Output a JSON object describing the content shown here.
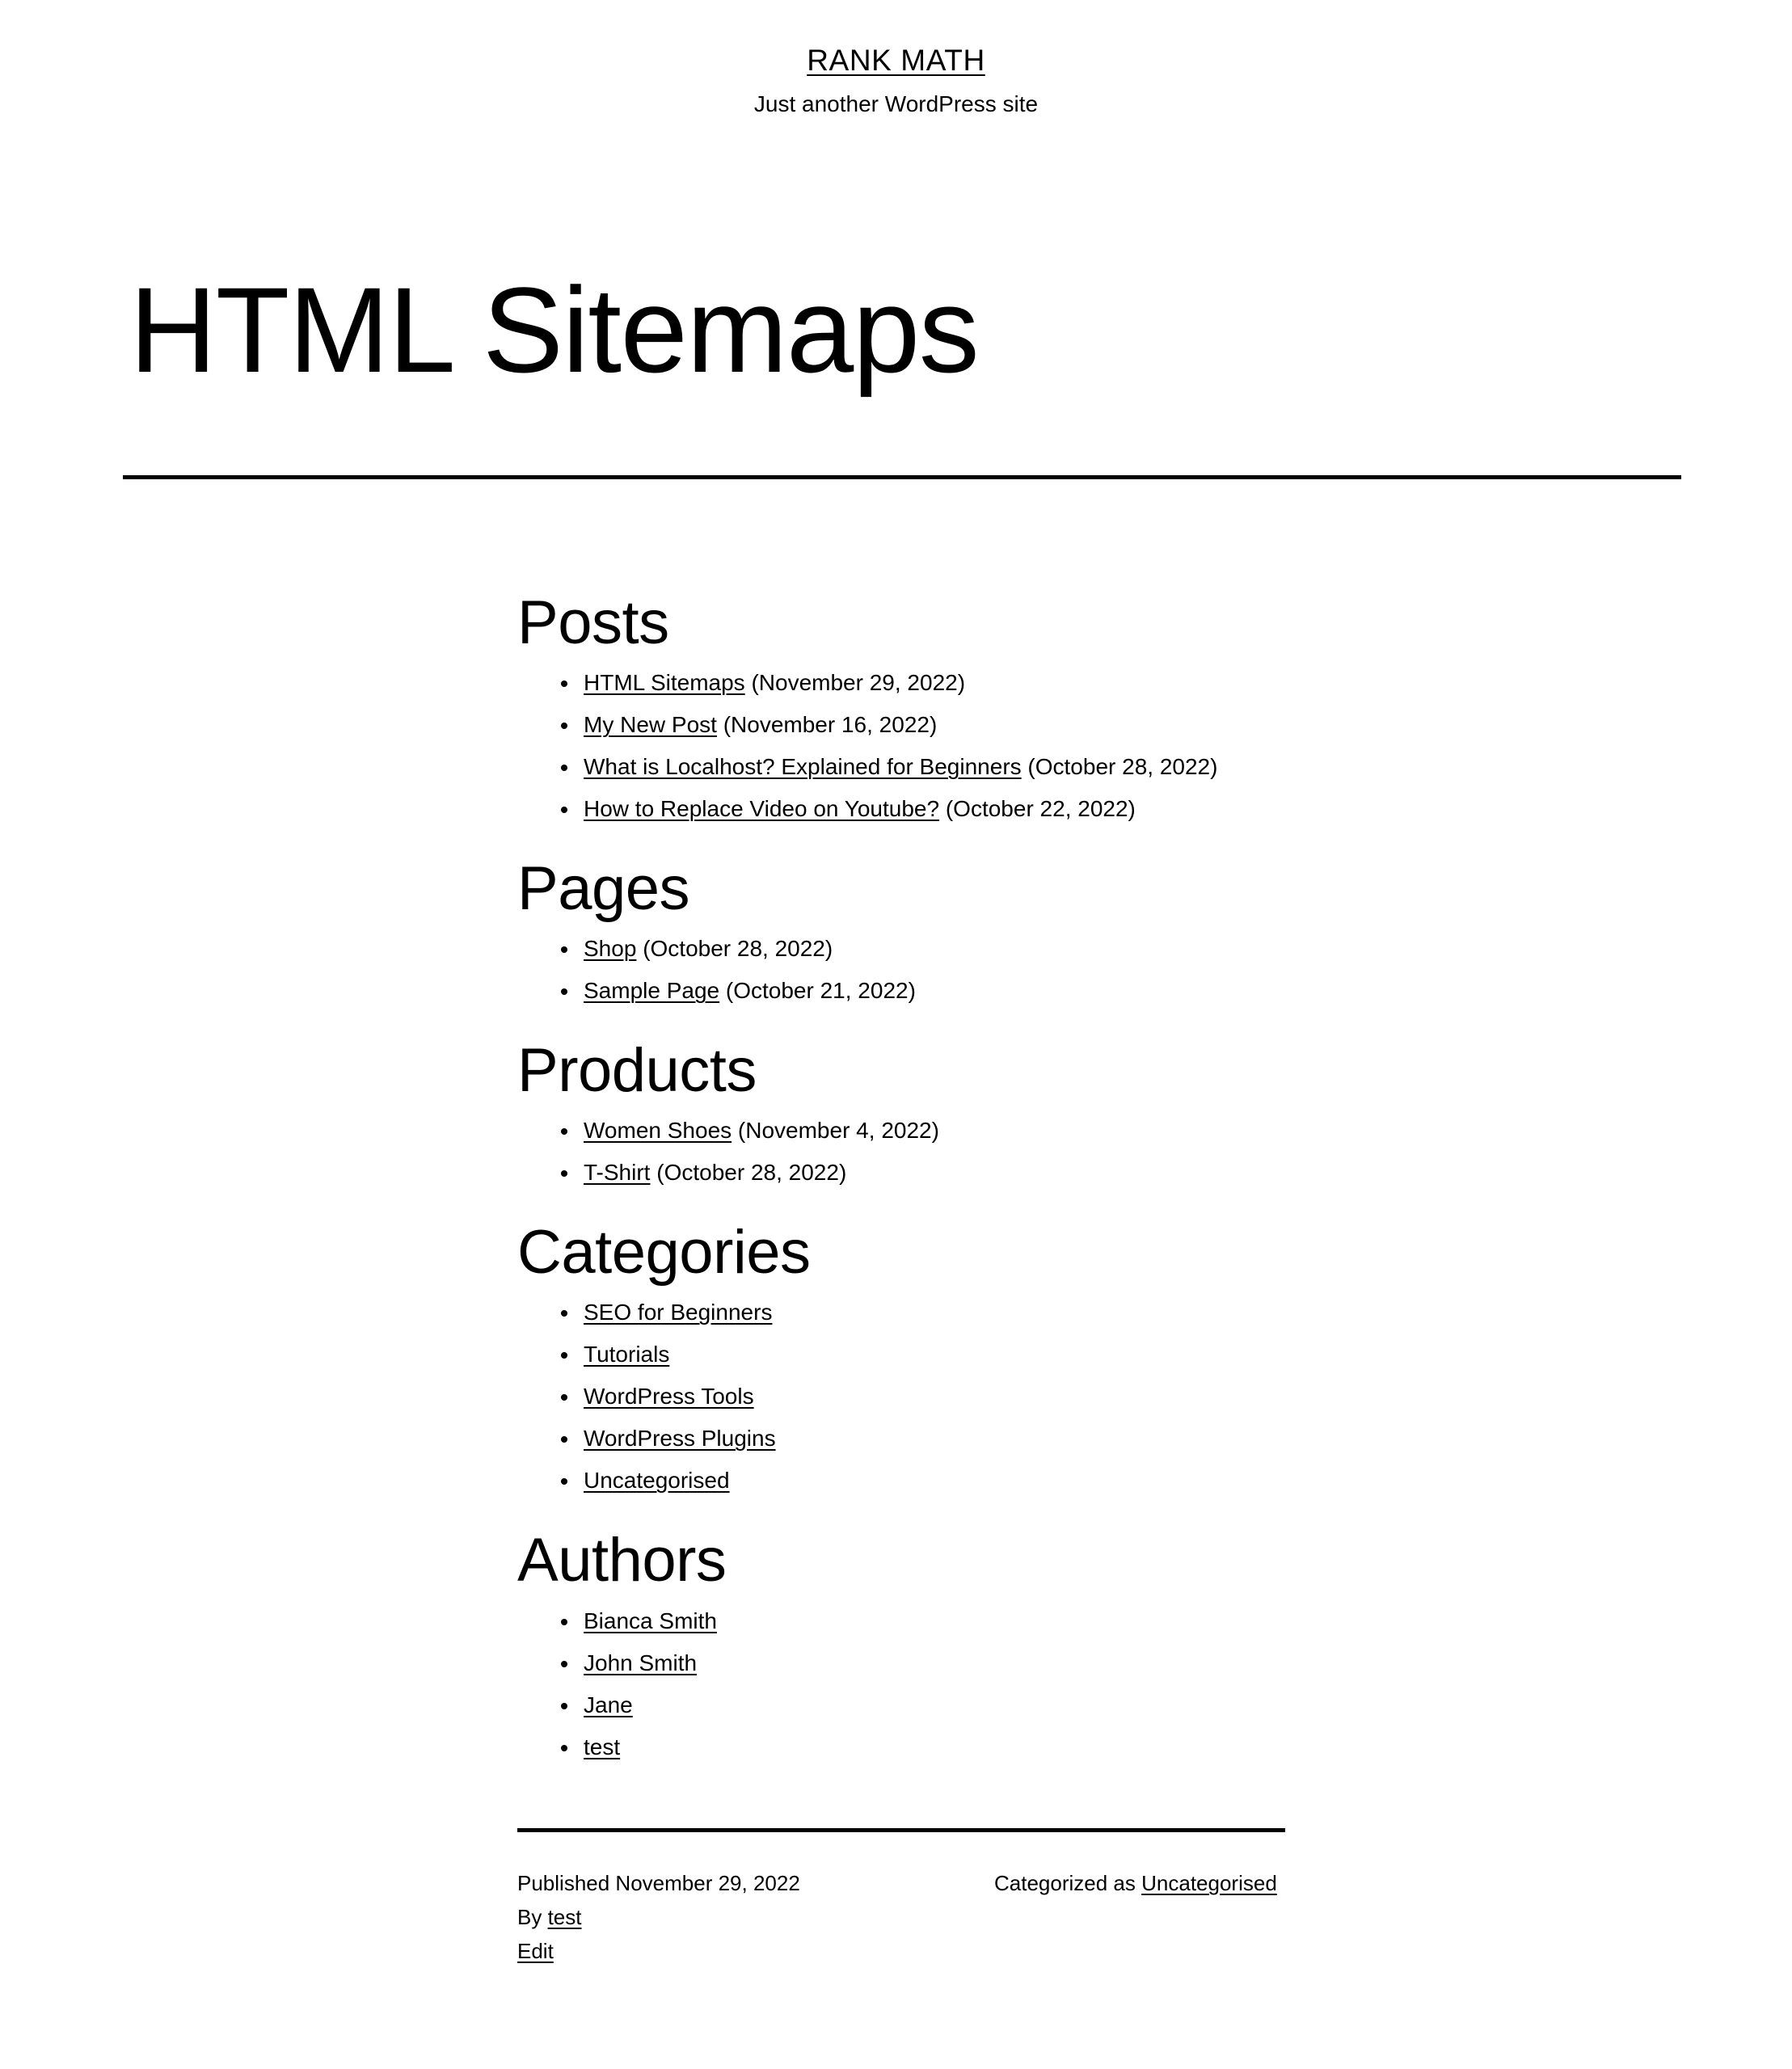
{
  "site": {
    "title": "RANK MATH",
    "tagline": "Just another WordPress site"
  },
  "entry": {
    "title": "HTML Sitemaps"
  },
  "sitemap": {
    "sections": [
      {
        "heading": "Posts",
        "items": [
          {
            "label": "HTML Sitemaps",
            "date": "(November 29, 2022)"
          },
          {
            "label": "My New Post",
            "date": "(November 16, 2022)"
          },
          {
            "label": "What is Localhost? Explained for Beginners",
            "date": "(October 28, 2022)"
          },
          {
            "label": "How to Replace Video on Youtube?",
            "date": "(October 22, 2022)"
          }
        ]
      },
      {
        "heading": "Pages",
        "items": [
          {
            "label": "Shop",
            "date": "(October 28, 2022)"
          },
          {
            "label": "Sample Page",
            "date": "(October 21, 2022)"
          }
        ]
      },
      {
        "heading": "Products",
        "items": [
          {
            "label": "Women Shoes",
            "date": "(November 4, 2022)"
          },
          {
            "label": "T-Shirt",
            "date": "(October 28, 2022)"
          }
        ]
      },
      {
        "heading": "Categories",
        "items": [
          {
            "label": "SEO for Beginners",
            "date": ""
          },
          {
            "label": "Tutorials",
            "date": ""
          },
          {
            "label": "WordPress Tools",
            "date": ""
          },
          {
            "label": "WordPress Plugins",
            "date": ""
          },
          {
            "label": "Uncategorised",
            "date": ""
          }
        ]
      },
      {
        "heading": "Authors",
        "items": [
          {
            "label": "Bianca Smith",
            "date": ""
          },
          {
            "label": "John Smith",
            "date": ""
          },
          {
            "label": "Jane",
            "date": ""
          },
          {
            "label": "test",
            "date": ""
          }
        ]
      }
    ]
  },
  "footer": {
    "published": "Published November 29, 2022",
    "by_prefix": "By",
    "author": "test",
    "edit": "Edit",
    "categorized_prefix": "Categorized as",
    "category": "Uncategorised"
  },
  "colors": {
    "text": "#000000",
    "background": "#ffffff",
    "rule": "#000000"
  }
}
